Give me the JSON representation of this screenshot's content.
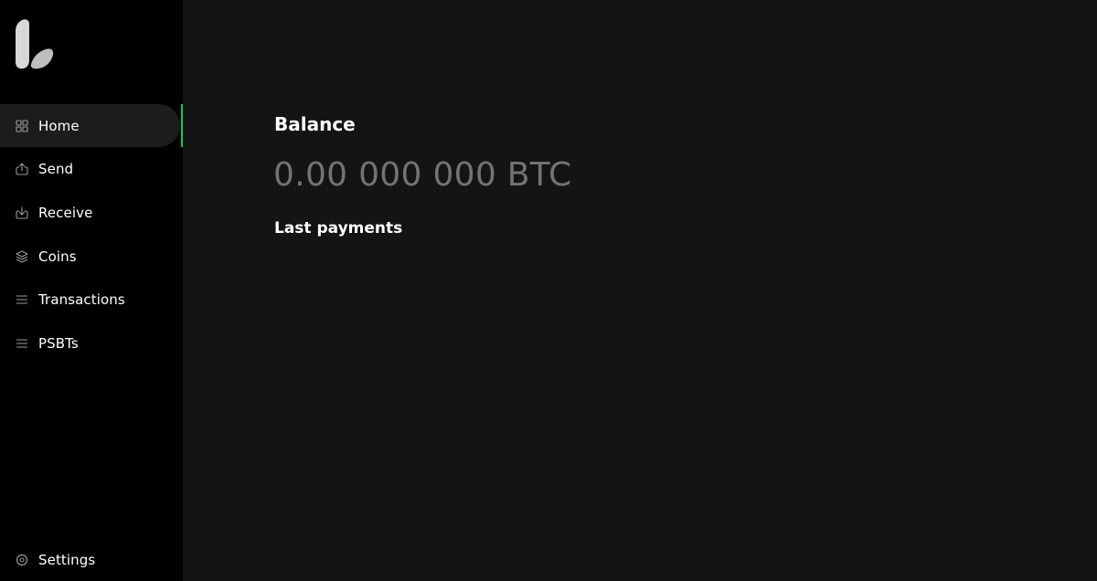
{
  "sidebar": {
    "logo": "liana-logo",
    "items": [
      {
        "label": "Home",
        "icon": "grid-icon",
        "active": true
      },
      {
        "label": "Send",
        "icon": "send-icon",
        "active": false
      },
      {
        "label": "Receive",
        "icon": "receive-icon",
        "active": false
      },
      {
        "label": "Coins",
        "icon": "coins-icon",
        "active": false
      },
      {
        "label": "Transactions",
        "icon": "list-icon",
        "active": false
      },
      {
        "label": "PSBTs",
        "icon": "list-icon",
        "active": false
      }
    ],
    "settings": {
      "label": "Settings",
      "icon": "gear-icon"
    }
  },
  "main": {
    "balance_title": "Balance",
    "balance_amount": "0.00 000 000 BTC",
    "last_payments_title": "Last payments"
  },
  "colors": {
    "accent": "#16c65b",
    "sidebar_bg": "#000000",
    "main_bg": "#141414",
    "active_item_bg": "#1c1c1c",
    "muted_text": "#737373"
  }
}
